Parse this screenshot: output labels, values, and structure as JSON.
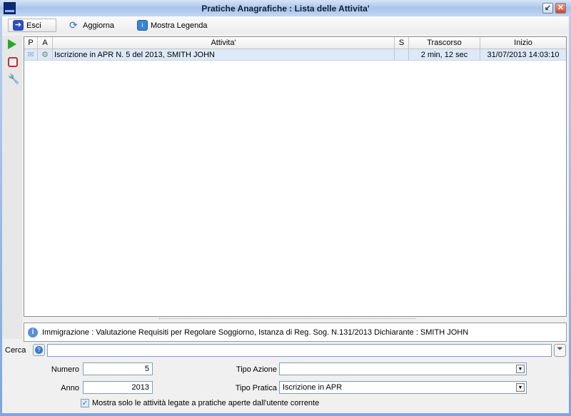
{
  "window": {
    "title": "Pratiche Anagrafiche : Lista delle Attivita'"
  },
  "toolbar": {
    "exit": "Esci",
    "refresh": "Aggiorna",
    "legend": "Mostra Legenda"
  },
  "grid": {
    "columns": [
      "P",
      "A",
      "Attivita'",
      "S",
      "Trascorso",
      "Inizio"
    ],
    "rows": [
      {
        "activity": "Iscrizione in APR  N. 5 del 2013, SMITH JOHN",
        "s": "",
        "elapsed": "2 min, 12 sec",
        "start": "31/07/2013 14:03:10"
      }
    ]
  },
  "info": {
    "text": "Immigrazione : Valutazione Requisiti per Regolare Soggiorno, Istanza di Reg. Sog. N.131/2013 Dichiarante : SMITH JOHN"
  },
  "search": {
    "label": "Cerca",
    "value": ""
  },
  "filters": {
    "numero_label": "Numero",
    "numero": "5",
    "anno_label": "Anno",
    "anno": "2013",
    "tipo_azione_label": "Tipo Azione",
    "tipo_azione": "",
    "tipo_pratica_label": "Tipo Pratica",
    "tipo_pratica": "Iscrizione in APR",
    "only_mine": "Mostra solo le attività legate a pratiche aperte dall'utente corrente"
  }
}
